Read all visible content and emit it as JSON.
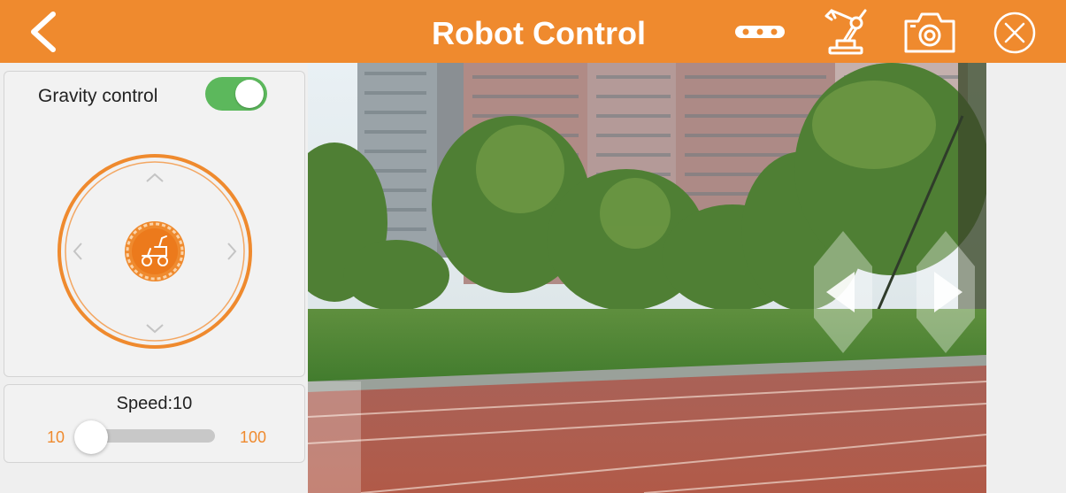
{
  "header": {
    "title": "Robot Control",
    "back_icon": "back-arrow-icon",
    "actions": [
      "more-dots-icon",
      "robot-arm-icon",
      "camera-icon",
      "close-icon"
    ]
  },
  "gravity": {
    "label": "Gravity control",
    "enabled": true
  },
  "speed": {
    "label": "Speed:10",
    "min": "10",
    "max": "100",
    "value": 10
  },
  "colors": {
    "accent": "#ef8a2e",
    "toggle_on": "#5cb85c"
  }
}
